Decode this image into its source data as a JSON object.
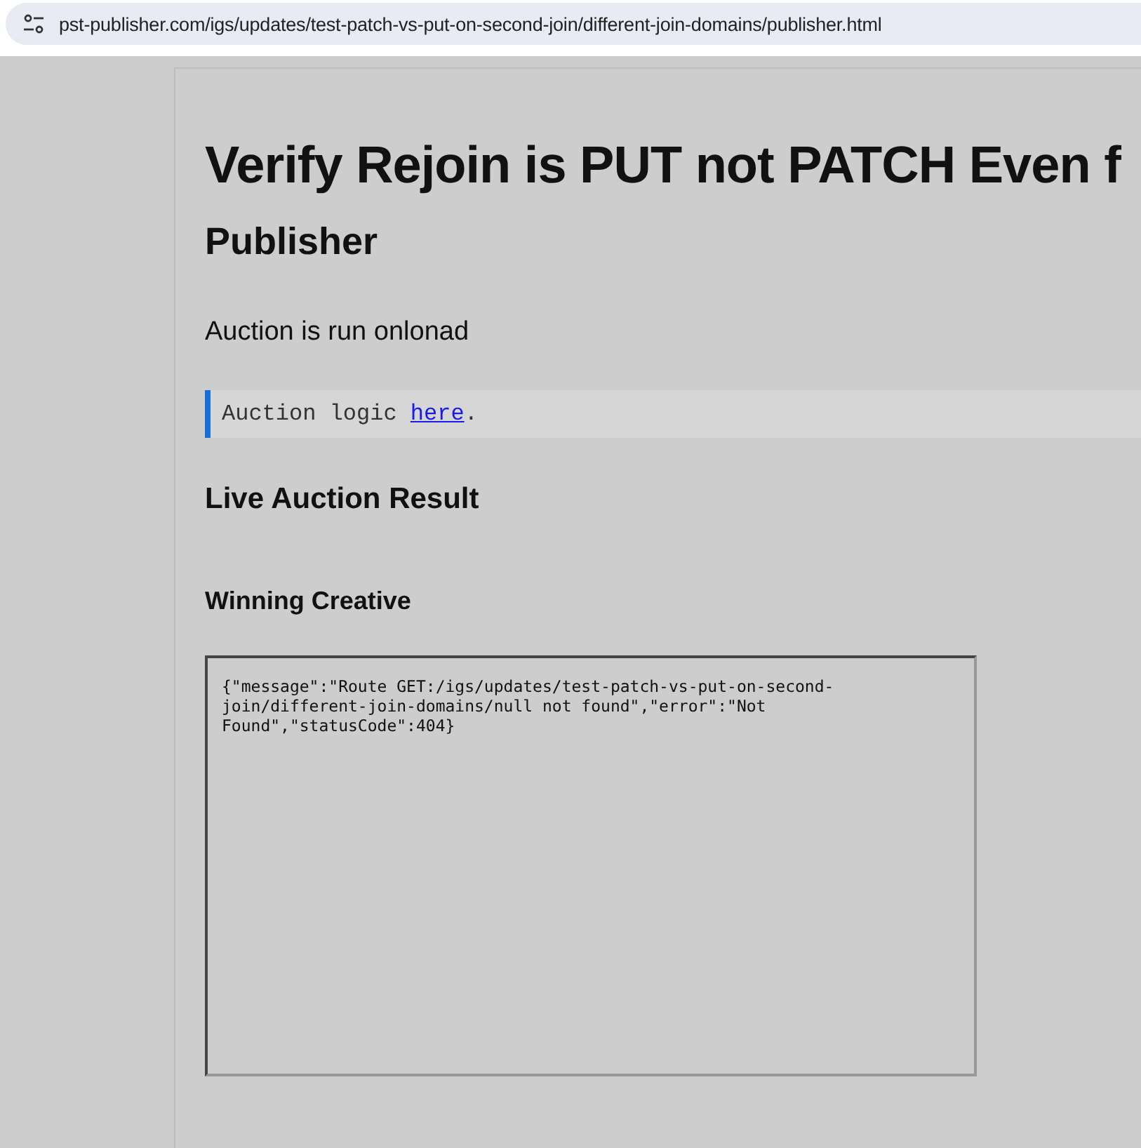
{
  "browser": {
    "url": "pst-publisher.com/igs/updates/test-patch-vs-put-on-second-join/different-join-domains/publisher.html"
  },
  "page": {
    "title": "Verify Rejoin is PUT not PATCH Even f",
    "subtitle": "Publisher",
    "intro": "Auction is run onlonad",
    "note": {
      "text": "Auction logic ",
      "link": "here",
      "after": "."
    },
    "section_heading": "Live Auction Result",
    "subheading": "Winning Creative",
    "frame_text": "{\"message\":\"Route GET:/igs/updates/test-patch-vs-put-on-second-join/different-join-domains/null not found\",\"error\":\"Not Found\",\"statusCode\":404}"
  }
}
